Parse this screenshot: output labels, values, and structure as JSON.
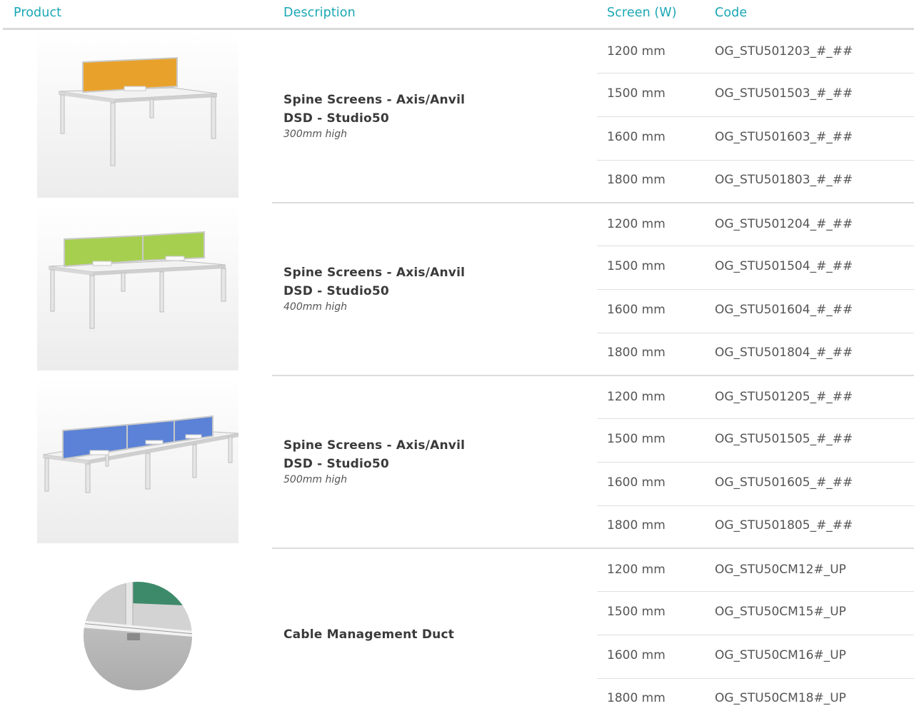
{
  "header": {
    "product": "Product",
    "description": "Description",
    "screen": "Screen (W)",
    "code": "Code"
  },
  "colors": {
    "accent": "#19a7b4",
    "screen_orange": "#e8a22c",
    "screen_green": "#a6cf4f",
    "screen_blue": "#5b82d6",
    "duct_green": "#3c8a6a"
  },
  "groups": [
    {
      "title_line1": "Spine Screens - Axis/Anvil",
      "title_line2": "DSD - Studio50",
      "subtitle": "300mm high",
      "image": "desk-orange-screen",
      "rows": [
        {
          "size": "1200 mm",
          "code": "OG_STU501203_#_##"
        },
        {
          "size": "1500 mm",
          "code": "OG_STU501503_#_##"
        },
        {
          "size": "1600 mm",
          "code": "OG_STU501603_#_##"
        },
        {
          "size": "1800 mm",
          "code": "OG_STU501803_#_##"
        }
      ]
    },
    {
      "title_line1": "Spine Screens - Axis/Anvil",
      "title_line2": "DSD - Studio50",
      "subtitle": "400mm high",
      "image": "desk-green-screen",
      "rows": [
        {
          "size": "1200 mm",
          "code": "OG_STU501204_#_##"
        },
        {
          "size": "1500 mm",
          "code": "OG_STU501504_#_##"
        },
        {
          "size": "1600 mm",
          "code": "OG_STU501604_#_##"
        },
        {
          "size": "1800 mm",
          "code": "OG_STU501804_#_##"
        }
      ]
    },
    {
      "title_line1": "Spine Screens - Axis/Anvil",
      "title_line2": "DSD - Studio50",
      "subtitle": "500mm high",
      "image": "desk-blue-screen",
      "rows": [
        {
          "size": "1200 mm",
          "code": "OG_STU501205_#_##"
        },
        {
          "size": "1500 mm",
          "code": "OG_STU501505_#_##"
        },
        {
          "size": "1600 mm",
          "code": "OG_STU501605_#_##"
        },
        {
          "size": "1800 mm",
          "code": "OG_STU501805_#_##"
        }
      ]
    },
    {
      "title_line1": "Cable Management Duct",
      "title_line2": "",
      "subtitle": "",
      "image": "cable-duct-closeup",
      "rows": [
        {
          "size": "1200 mm",
          "code": "OG_STU50CM12#_UP"
        },
        {
          "size": "1500 mm",
          "code": "OG_STU50CM15#_UP"
        },
        {
          "size": "1600 mm",
          "code": "OG_STU50CM16#_UP"
        },
        {
          "size": "1800 mm",
          "code": "OG_STU50CM18#_UP"
        }
      ]
    }
  ]
}
